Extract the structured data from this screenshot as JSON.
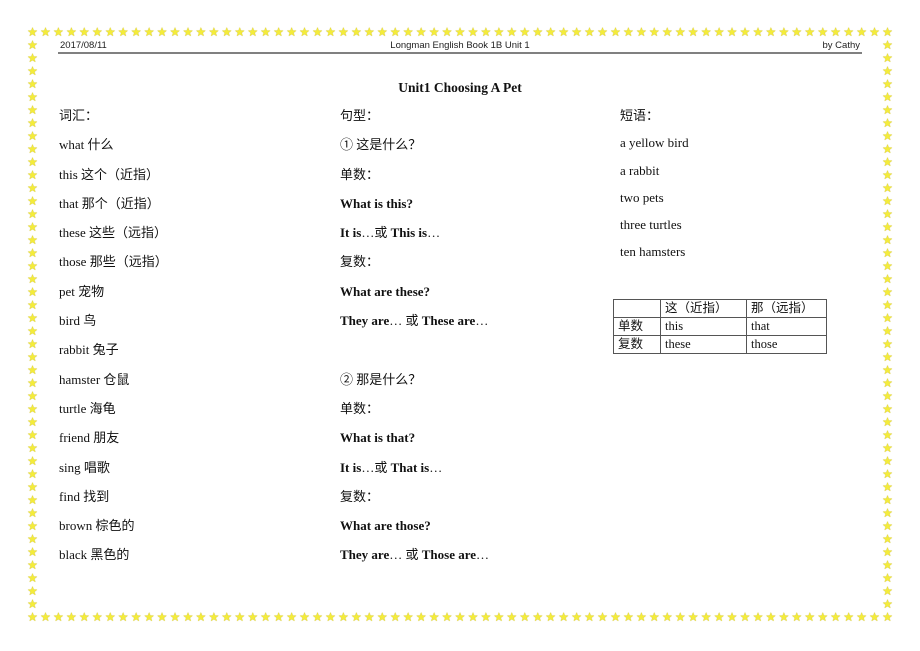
{
  "header": {
    "date": "2017/08/11",
    "book": "Longman English Book 1B Unit 1",
    "author": "by Cathy"
  },
  "title": "Unit1  Choosing A Pet",
  "border": {
    "icon": "star-icon",
    "glyph": "★",
    "color": "#f4ec3a"
  },
  "vocabulary": {
    "heading": "词汇：",
    "items": [
      "what 什么",
      "this 这个（近指）",
      "that 那个（近指）",
      "these 这些（远指）",
      "those 那些（远指）",
      "pet 宠物",
      "bird 鸟",
      "rabbit 兔子",
      "hamster 仓鼠",
      "turtle 海龟",
      "friend 朋友",
      "sing 唱歌",
      "find 找到",
      "brown 棕色的",
      "black 黑色的"
    ]
  },
  "sentences": {
    "heading": "句型：",
    "section1": {
      "title": "① 这是什么？",
      "singular_label": "单数：",
      "singular_q": "What is this?",
      "singular_a_1": "It is",
      "singular_a_2": "…或 ",
      "singular_a_3": "This is",
      "singular_a_4": "…",
      "plural_label": "复数：",
      "plural_q": "What are these?",
      "plural_a_1": "They are",
      "plural_a_2": "… 或 ",
      "plural_a_3": "These are",
      "plural_a_4": "…"
    },
    "section2": {
      "title": "② 那是什么？",
      "singular_label": "单数：",
      "singular_q": "What is that?",
      "singular_a_1": "It is",
      "singular_a_2": "…或 ",
      "singular_a_3": "That is",
      "singular_a_4": "…",
      "plural_label": "复数：",
      "plural_q": "What are those?",
      "plural_a_1": "They are",
      "plural_a_2": "… 或 ",
      "plural_a_3": "Those are",
      "plural_a_4": "…"
    }
  },
  "phrases": {
    "heading": "短语：",
    "items": [
      "a yellow bird",
      "a rabbit",
      "two pets",
      "three turtles",
      "ten hamsters"
    ]
  },
  "table": {
    "headers": [
      "",
      "这（近指）",
      "那（远指）"
    ],
    "rows": [
      [
        "单数",
        "this",
        "that"
      ],
      [
        "复数",
        "these",
        "those"
      ]
    ]
  }
}
